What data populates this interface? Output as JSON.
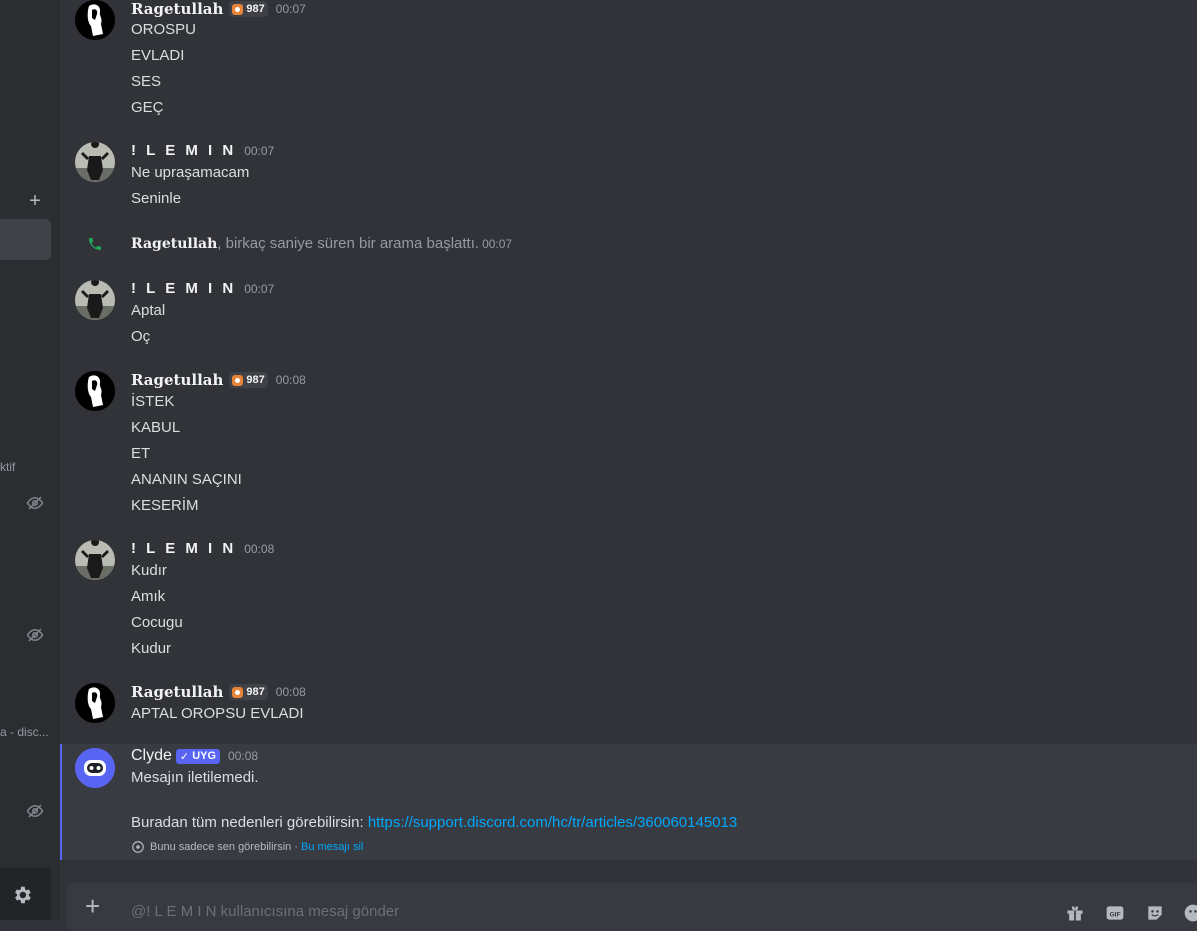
{
  "sidebar": {
    "plus_label": "+",
    "labels": [
      "ktif",
      "a - disc..."
    ]
  },
  "messages": [
    {
      "author": "Ragetullah",
      "guild_tag": "987",
      "time": "00:07",
      "lines": [
        "OROSPU",
        "EVLADI",
        "SES",
        "GEÇ"
      ]
    },
    {
      "author": "! L E M I N",
      "time": "00:07",
      "lines": [
        "Ne upraşamacam",
        "Seninle"
      ]
    },
    {
      "author": "! L E M I N",
      "time": "00:07",
      "lines": [
        "Aptal",
        "Oç"
      ]
    },
    {
      "author": "Ragetullah",
      "guild_tag": "987",
      "time": "00:08",
      "lines": [
        "İSTEK",
        "KABUL",
        "ET",
        "ANANIN SAÇINI",
        "KESERİM"
      ]
    },
    {
      "author": "! L E M I N",
      "time": "00:08",
      "lines": [
        "Kudır",
        "Amık",
        "Cocugu",
        "Kudur"
      ]
    },
    {
      "author": "Ragetullah",
      "guild_tag": "987",
      "time": "00:08",
      "lines": [
        "APTAL OROPSU EVLADI"
      ]
    }
  ],
  "call_event": {
    "author": "Ragetullah",
    "text": ", birkaç saniye süren bir arama başlattı.",
    "time": "00:07"
  },
  "clyde": {
    "author": "Clyde",
    "tag": "UYG",
    "time": "00:08",
    "line1": "Mesajın iletilemedi.",
    "line2_prefix": "Buradan tüm nedenleri görebilirsin: ",
    "link": "https://support.discord.com/hc/tr/articles/360060145013",
    "ephemeral_note": "Bunu sadece sen görebilirsin · ",
    "delete_label": "Bu mesajı sil"
  },
  "composer": {
    "placeholder": "@! L E M I N kullanıcısına mesaj gönder",
    "plus": "+"
  },
  "colors": {
    "accent": "#5865f2",
    "link": "#00a8fc",
    "call_green": "#23a55a"
  }
}
